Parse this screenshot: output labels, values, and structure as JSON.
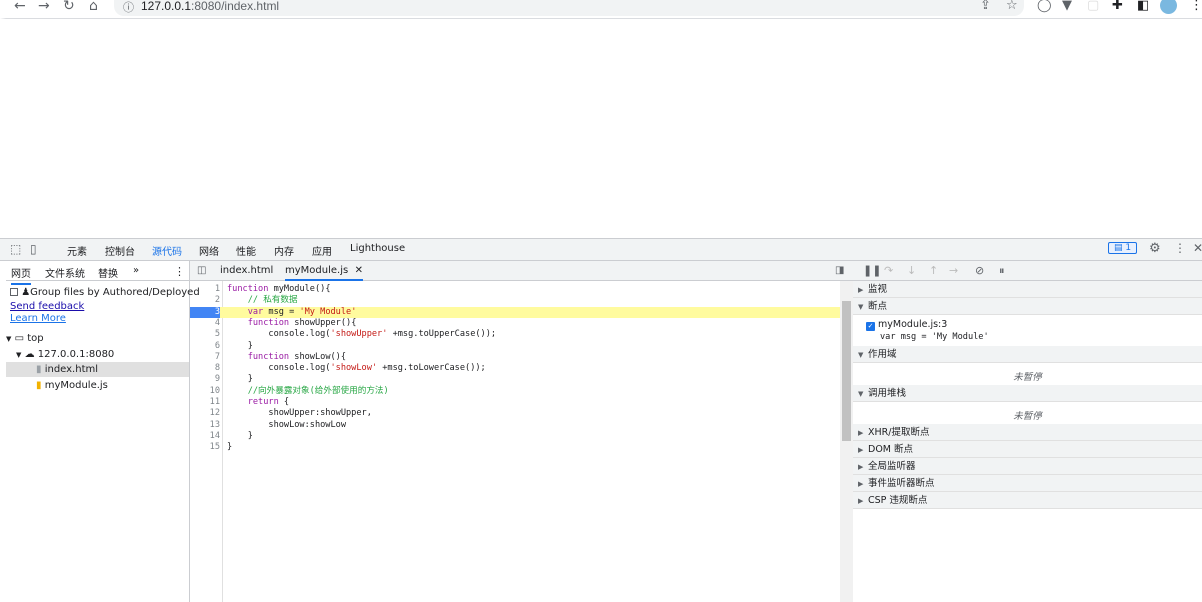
{
  "browser": {
    "url_host": "127.0.0.1",
    "url_rest": ":8080/index.html"
  },
  "devtools": {
    "main_tabs": [
      "元素",
      "控制台",
      "源代码",
      "网络",
      "性能",
      "内存",
      "应用",
      "Lighthouse"
    ],
    "active_tab": "源代码",
    "issues_count": "1",
    "left": {
      "tabs": [
        "网页",
        "文件系统",
        "替换",
        "»"
      ],
      "group_files_label": "Group files by Authored/Deployed",
      "send_feedback": "Send feedback",
      "learn_more": "Learn More",
      "tree": {
        "top": "top",
        "host": "127.0.0.1:8080",
        "files": [
          "index.html",
          "myModule.js"
        ]
      }
    },
    "editor": {
      "open_files": [
        "index.html",
        "myModule.js"
      ],
      "active_file": "myModule.js",
      "highlighted_line": 3,
      "lines": [
        "function myModule(){",
        "    // 私有数据",
        "    var msg = 'My Module'",
        "    function showUpper(){",
        "        console.log('showUpper' +msg.toUpperCase());",
        "    }",
        "    function showLow(){",
        "        console.log('showLow' +msg.toLowerCase());",
        "    }",
        "    //向外暴露对象(给外部使用的方法)",
        "    return {",
        "        showUpper:showUpper,",
        "        showLow:showLow",
        "    }",
        "}"
      ]
    },
    "right": {
      "sections": {
        "watch": "监视",
        "breakpoints": "断点",
        "scope": "作用域",
        "callstack": "调用堆栈",
        "xhr": "XHR/提取断点",
        "dom": "DOM 断点",
        "global": "全局监听器",
        "event": "事件监听器断点",
        "csp": "CSP 违规断点"
      },
      "breakpoint_file": "myModule.js:3",
      "breakpoint_code": "var msg = 'My Module'",
      "not_paused_1": "未暂停",
      "not_paused_2": "未暂停"
    }
  }
}
